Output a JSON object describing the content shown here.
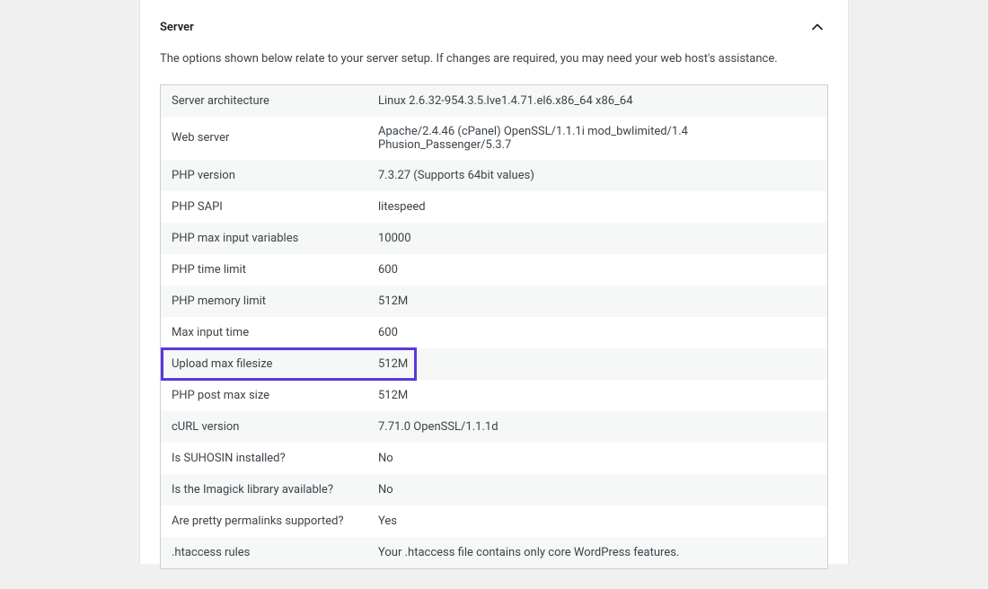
{
  "panel": {
    "title": "Server",
    "description": "The options shown below relate to your server setup. If changes are required, you may need your web host's assistance."
  },
  "rows": [
    {
      "label": "Server architecture",
      "value": "Linux 2.6.32-954.3.5.lve1.4.71.el6.x86_64 x86_64"
    },
    {
      "label": "Web server",
      "value": "Apache/2.4.46 (cPanel) OpenSSL/1.1.1i mod_bwlimited/1.4 Phusion_Passenger/5.3.7"
    },
    {
      "label": "PHP version",
      "value": "7.3.27 (Supports 64bit values)"
    },
    {
      "label": "PHP SAPI",
      "value": "litespeed"
    },
    {
      "label": "PHP max input variables",
      "value": "10000"
    },
    {
      "label": "PHP time limit",
      "value": "600"
    },
    {
      "label": "PHP memory limit",
      "value": "512M"
    },
    {
      "label": "Max input time",
      "value": "600"
    },
    {
      "label": "Upload max filesize",
      "value": "512M"
    },
    {
      "label": "PHP post max size",
      "value": "512M"
    },
    {
      "label": "cURL version",
      "value": "7.71.0 OpenSSL/1.1.1d"
    },
    {
      "label": "Is SUHOSIN installed?",
      "value": "No"
    },
    {
      "label": "Is the Imagick library available?",
      "value": "No"
    },
    {
      "label": "Are pretty permalinks supported?",
      "value": "Yes"
    },
    {
      "label": ".htaccess rules",
      "value": "Your .htaccess file contains only core WordPress features."
    }
  ],
  "highlight_index": 8
}
